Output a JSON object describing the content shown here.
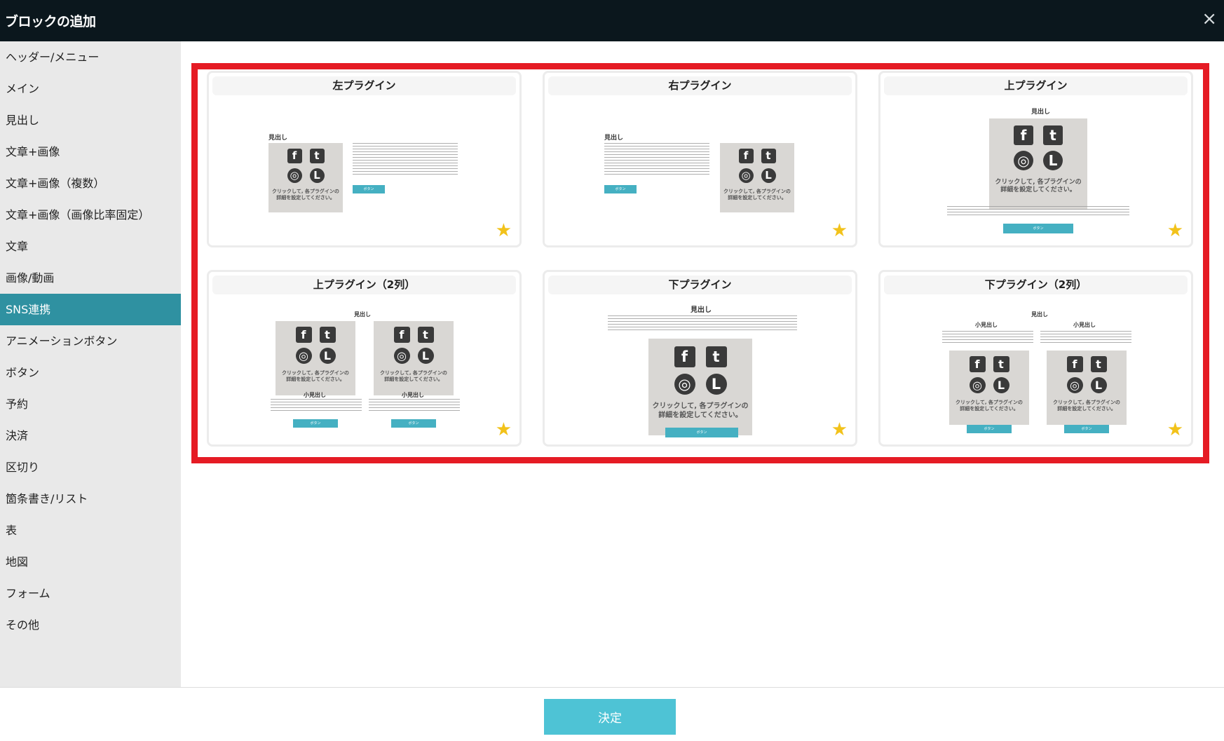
{
  "dialog": {
    "title": "ブロックの追加",
    "close_label": "×"
  },
  "sidebar": {
    "items": [
      {
        "label": "ヘッダー/メニュー"
      },
      {
        "label": "メイン"
      },
      {
        "label": "見出し"
      },
      {
        "label": "文章+画像"
      },
      {
        "label": "文章+画像（複数）"
      },
      {
        "label": "文章+画像（画像比率固定）"
      },
      {
        "label": "文章"
      },
      {
        "label": "画像/動画"
      },
      {
        "label": "SNS連携",
        "active": true
      },
      {
        "label": "アニメーションボタン"
      },
      {
        "label": "ボタン"
      },
      {
        "label": "予約"
      },
      {
        "label": "決済"
      },
      {
        "label": "区切り"
      },
      {
        "label": "箇条書き/リスト"
      },
      {
        "label": "表"
      },
      {
        "label": "地図"
      },
      {
        "label": "フォーム"
      },
      {
        "label": "その他"
      }
    ]
  },
  "templates": [
    {
      "title": "左プラグイン"
    },
    {
      "title": "右プラグイン"
    },
    {
      "title": "上プラグイン"
    },
    {
      "title": "上プラグイン（2列）"
    },
    {
      "title": "下プラグイン"
    },
    {
      "title": "下プラグイン（2列）"
    }
  ],
  "preview": {
    "heading": "見出し",
    "subheading": "小見出し",
    "sns_caption": "クリックして, 各プラグインの\n詳細を設定してください。",
    "button_label": "ボタン"
  },
  "icons": {
    "favorite": "star-icon",
    "close": "close-icon"
  },
  "colors": {
    "header_bg": "#0b171d",
    "active_item": "#2f91a1",
    "highlight_frame": "#e51b24",
    "star": "#f2c21a",
    "confirm_button": "#4ec3d5"
  },
  "footer": {
    "confirm_label": "決定"
  }
}
